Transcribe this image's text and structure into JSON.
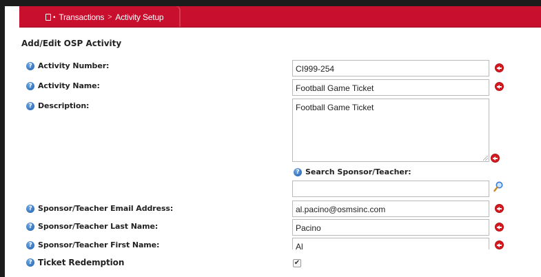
{
  "breadcrumb": {
    "section": "Transactions",
    "separator": ">",
    "current": "Activity Setup"
  },
  "form": {
    "title": "Add/Edit OSP Activity",
    "fields": {
      "activity_number": {
        "label": "Activity Number:",
        "value": "CI999-254"
      },
      "activity_name": {
        "label": "Activity Name:",
        "value": "Football Game Ticket"
      },
      "description": {
        "label": "Description:",
        "value": "Football Game Ticket"
      },
      "search_sponsor": {
        "label": "Search Sponsor/Teacher:",
        "value": ""
      },
      "sponsor_email": {
        "label": "Sponsor/Teacher Email Address:",
        "value": "al.pacino@osmsinc.com"
      },
      "sponsor_last_name": {
        "label": "Sponsor/Teacher Last Name:",
        "value": "Pacino"
      },
      "sponsor_first_name": {
        "label": "Sponsor/Teacher First Name:",
        "value": "Al"
      },
      "ticket_redemption": {
        "label": "Ticket Redemption",
        "checked": true
      }
    }
  },
  "icons": {
    "help": "help-circle-icon",
    "required": "required-arrow-icon",
    "search": "magnifier-icon",
    "check_glyph": "✔"
  },
  "colors": {
    "nav_red": "#c8102e",
    "required_red": "#d7191f",
    "help_blue": "#1f5fb3"
  }
}
